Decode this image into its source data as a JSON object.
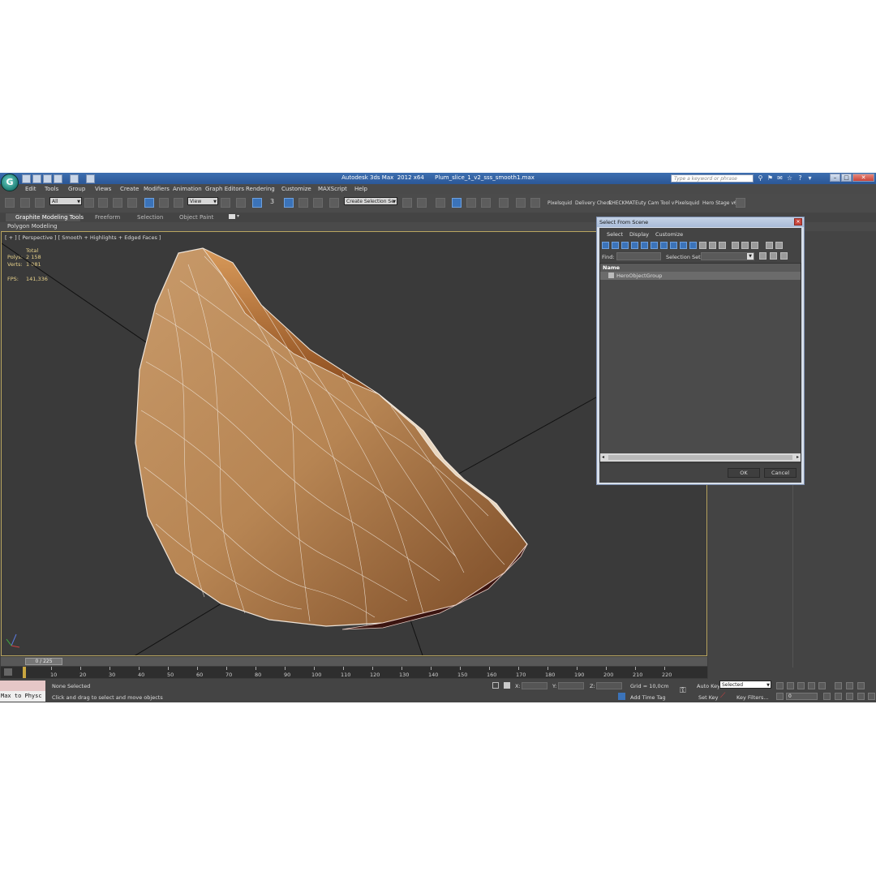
{
  "app": {
    "title": "Autodesk 3ds Max  2012 x64      Plum_slice_1_v2_sss_smooth1.max",
    "search_placeholder": "Type a keyword or phrase"
  },
  "menu": [
    "Edit",
    "Tools",
    "Group",
    "Views",
    "Create",
    "Modifiers",
    "Animation",
    "Graph Editors",
    "Rendering",
    "Customize",
    "MAXScript",
    "Help"
  ],
  "toolbar": {
    "filter_value": "All",
    "coord_value": "View",
    "selection_set_value": "Create Selection Se",
    "num_label": "3",
    "plugins": [
      "Pixelsquid",
      "Delivery Check",
      "CHECKMATE",
      "uty Cam Tool v",
      "Pixelsquid",
      "Hero Stage v6"
    ]
  },
  "ribbon": {
    "tabs": [
      "Graphite Modeling Tools",
      "Freeform",
      "Selection",
      "Object Paint"
    ],
    "sub_label": "Polygon Modeling"
  },
  "viewport": {
    "caption": "[ + ] [ Perspective ] [ Smooth + Highlights + Edged Faces ]",
    "stats_header": "Total",
    "polys_label": "Polys:",
    "polys_value": "2 158",
    "verts_label": "Verts:",
    "verts_value": "1 081",
    "fps_label": "FPS:",
    "fps_value": "141,336"
  },
  "timeline": {
    "frame_display": "0 / 225",
    "ticks": [
      "10",
      "20",
      "30",
      "40",
      "50",
      "60",
      "70",
      "80",
      "90",
      "100",
      "110",
      "120",
      "130",
      "140",
      "150",
      "160",
      "170",
      "180",
      "190",
      "200",
      "210",
      "220"
    ]
  },
  "status": {
    "maxscript_label": "Max to Physc",
    "selection_status": "None Selected",
    "prompt": "Click and drag to select and move objects",
    "x_label": "X:",
    "y_label": "Y:",
    "z_label": "Z:",
    "grid": "Grid = 10,0cm",
    "add_time_tag": "Add Time Tag",
    "auto_key": "Auto Key",
    "set_key": "Set Key",
    "key_mode_value": "Selected",
    "key_filters": "Key Filters...",
    "frame_value": "0"
  },
  "dialog": {
    "title": "Select From Scene",
    "menu": [
      "Select",
      "Display",
      "Customize"
    ],
    "find_label": "Find:",
    "selection_set_label": "Selection Set:",
    "column_name": "Name",
    "items": [
      "HeroObjectGroup"
    ],
    "ok": "OK",
    "cancel": "Cancel"
  },
  "colors": {
    "titlebar": "#2b5797",
    "viewport_bg": "#3a3a3a",
    "viewport_border": "#b9a560",
    "stats_text": "#e8d28a",
    "tool_active": "#3b73b9"
  }
}
